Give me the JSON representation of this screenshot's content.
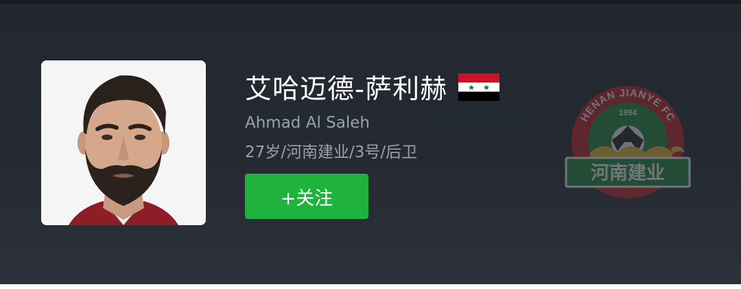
{
  "player": {
    "name_cn": "艾哈迈德-萨利赫",
    "name_en": "Ahmad Al Saleh",
    "meta": "27岁/河南建业/3号/后卫",
    "flag_icon": "syria-flag-icon",
    "flag_colors": [
      "#ce1126",
      "#ffffff",
      "#000000",
      "#007a3d"
    ]
  },
  "follow_button": {
    "label": "+关注",
    "color": "#1fb33e"
  },
  "club_logo": {
    "top_text": "HENAN JIANYE FC",
    "year": "1994",
    "banner_text": "河南建业",
    "icon": "club-crest-icon",
    "colors": [
      "#c8242b",
      "#1e8b3c",
      "#f2c230"
    ]
  }
}
